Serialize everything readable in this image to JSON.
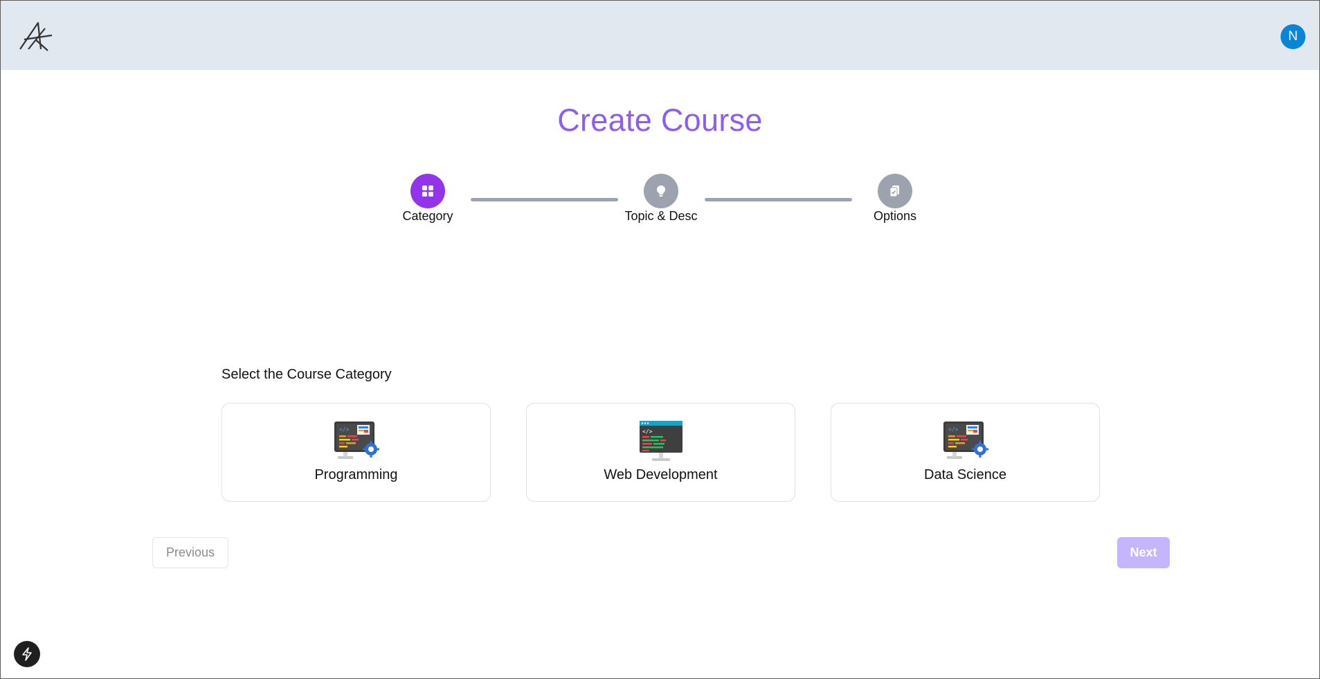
{
  "header": {
    "logo_icon": "app-logo-icon",
    "avatar_initial": "N",
    "avatar_color": "#0a84d6",
    "background": "#e2e8f0"
  },
  "page": {
    "title": "Create Course",
    "title_color": "#8b5cf6"
  },
  "stepper": {
    "steps": [
      {
        "label": "Category",
        "icon": "grid-icon",
        "state": "active"
      },
      {
        "label": "Topic & Desc",
        "icon": "lightbulb-icon",
        "state": "inactive"
      },
      {
        "label": "Options",
        "icon": "clipboard-check-icon",
        "state": "inactive"
      }
    ],
    "active_color": "#9333ea",
    "inactive_color": "#9ca3af"
  },
  "category_section": {
    "label": "Select the Course Category",
    "categories": [
      {
        "name": "Programming",
        "icon": "programming-monitor-icon"
      },
      {
        "name": "Web Development",
        "icon": "web-development-monitor-icon"
      },
      {
        "name": "Data Science",
        "icon": "data-science-monitor-icon"
      }
    ]
  },
  "navigation": {
    "previous_label": "Previous",
    "next_label": "Next",
    "next_color": "#c4b5fd"
  },
  "floating": {
    "icon": "lightning-bolt-icon"
  }
}
